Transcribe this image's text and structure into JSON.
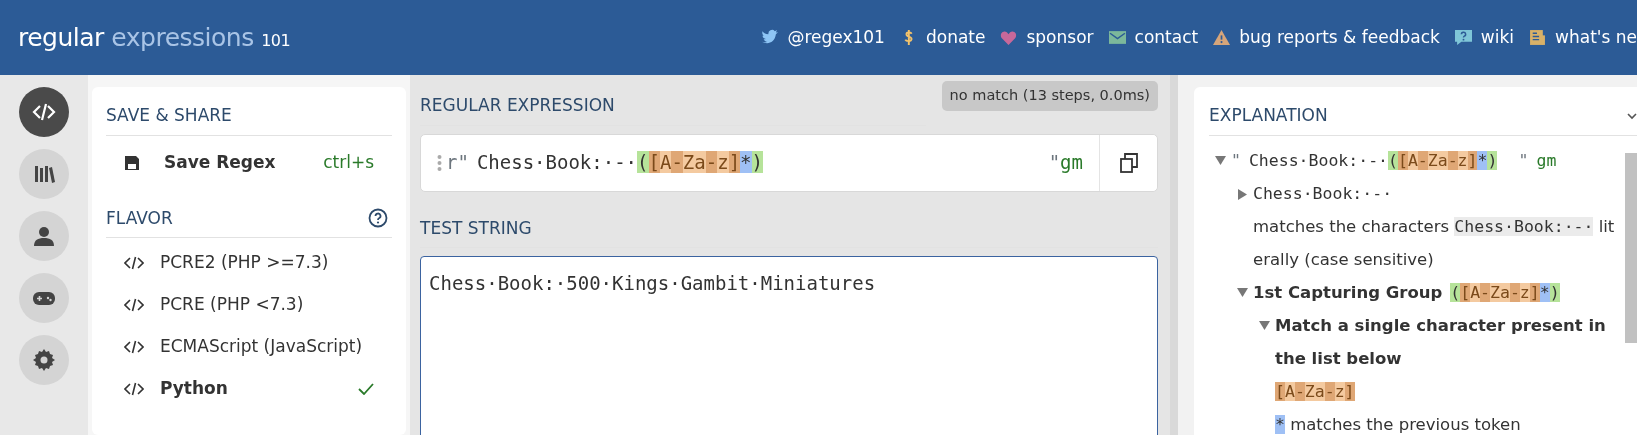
{
  "header": {
    "logo_main": "regular",
    "logo_accent": "expressions",
    "logo_version": "101",
    "nav": [
      {
        "label": "@regex101"
      },
      {
        "label": "donate"
      },
      {
        "label": "sponsor"
      },
      {
        "label": "contact"
      },
      {
        "label": "bug reports & feedback"
      },
      {
        "label": "wiki"
      },
      {
        "label": "what's ne"
      }
    ]
  },
  "rail": [
    {
      "selected": true
    },
    {
      "selected": false
    },
    {
      "selected": false
    },
    {
      "selected": false
    },
    {
      "selected": false
    }
  ],
  "sidebar": {
    "save_title": "SAVE & SHARE",
    "save_label": "Save Regex",
    "save_shortcut": "ctrl+s",
    "flavor_title": "FLAVOR",
    "flavors": [
      {
        "label": "PCRE2 (PHP >=7.3)",
        "selected": false
      },
      {
        "label": "PCRE (PHP <7.3)",
        "selected": false
      },
      {
        "label": "ECMAScript (JavaScript)",
        "selected": false
      },
      {
        "label": "Python",
        "selected": true
      }
    ]
  },
  "regex": {
    "title": "REGULAR EXPRESSION",
    "status": "no match (13 steps, 0.0ms)",
    "prefix": "r\"",
    "suffix": "\"",
    "flags": "gm",
    "tokens": [
      {
        "text": "Chess·Book:·-·",
        "kind": "literal"
      },
      {
        "text": "(",
        "kind": "group"
      },
      {
        "text": "[",
        "kind": "class-edge"
      },
      {
        "text": "A",
        "kind": "class"
      },
      {
        "text": "-",
        "kind": "class-edge"
      },
      {
        "text": "Za",
        "kind": "class"
      },
      {
        "text": "-",
        "kind": "class-edge"
      },
      {
        "text": "z",
        "kind": "class"
      },
      {
        "text": "]",
        "kind": "class-edge"
      },
      {
        "text": "*",
        "kind": "quantifier"
      },
      {
        "text": ")",
        "kind": "group"
      }
    ]
  },
  "test": {
    "title": "TEST STRING",
    "value": "Chess·Book:·500·Kings·Gambit·Miniatures"
  },
  "explanation": {
    "title": "EXPLANATION",
    "tree": [
      {
        "expanded": true,
        "prefix": "\"",
        "suffix": "\"",
        "flags": "gm",
        "tokens": [
          {
            "text": "Chess·Book:·-·",
            "kind": "literal"
          },
          {
            "text": "(",
            "kind": "group"
          },
          {
            "text": "[",
            "kind": "class-edge"
          },
          {
            "text": "A",
            "kind": "class"
          },
          {
            "text": "-",
            "kind": "class-edge"
          },
          {
            "text": "Za",
            "kind": "class"
          },
          {
            "text": "-",
            "kind": "class-edge"
          },
          {
            "text": "z",
            "kind": "class"
          },
          {
            "text": "]",
            "kind": "class-edge"
          },
          {
            "text": "*",
            "kind": "quantifier"
          },
          {
            "text": ")",
            "kind": "group"
          }
        ],
        "children": [
          {
            "expanded": false,
            "tokens": [
              {
                "text": "Chess·Book:·-·",
                "kind": "literal"
              }
            ],
            "text_before": "matches the characters",
            "code": "Chess·Book:·-·",
            "text_after": "literally (case sensitive)"
          },
          {
            "expanded": true,
            "label": "1st Capturing Group",
            "tokens": [
              {
                "text": "(",
                "kind": "group"
              },
              {
                "text": "[",
                "kind": "class-edge"
              },
              {
                "text": "A",
                "kind": "class"
              },
              {
                "text": "-",
                "kind": "class-edge"
              },
              {
                "text": "Za",
                "kind": "class"
              },
              {
                "text": "-",
                "kind": "class-edge"
              },
              {
                "text": "z",
                "kind": "class"
              },
              {
                "text": "]",
                "kind": "class-edge"
              },
              {
                "text": "*",
                "kind": "quantifier"
              },
              {
                "text": ")",
                "kind": "group"
              }
            ],
            "children": [
              {
                "expanded": true,
                "label": "Match a single character present in the list below",
                "tokens": [
                  {
                    "text": "[",
                    "kind": "class-edge"
                  },
                  {
                    "text": "A",
                    "kind": "class"
                  },
                  {
                    "text": "-",
                    "kind": "class-edge"
                  },
                  {
                    "text": "Za",
                    "kind": "class"
                  },
                  {
                    "text": "-",
                    "kind": "class-edge"
                  },
                  {
                    "text": "z",
                    "kind": "class"
                  },
                  {
                    "text": "]",
                    "kind": "class-edge"
                  }
                ]
              },
              {
                "tokens": [
                  {
                    "text": "*",
                    "kind": "quantifier"
                  }
                ],
                "text_before": "matches the previous token"
              }
            ]
          }
        ]
      }
    ]
  }
}
